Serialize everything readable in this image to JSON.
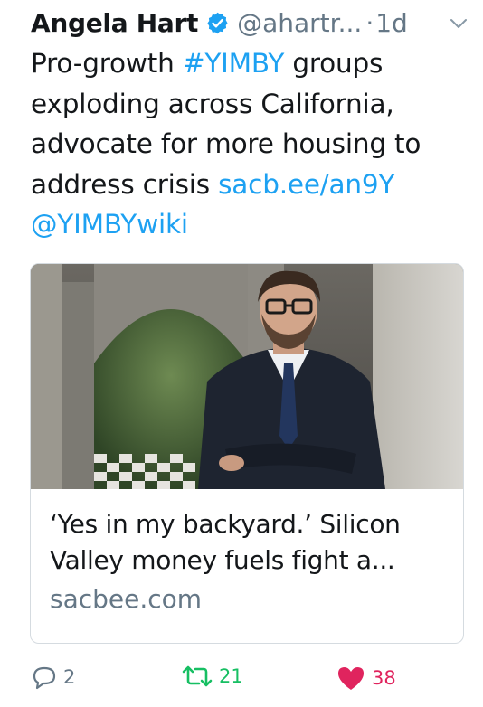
{
  "tweet": {
    "author_name": "Angela Hart",
    "handle": "@ahartr...",
    "separator": "·",
    "time": "1d",
    "text_parts": [
      {
        "text": "Pro-growth ",
        "link": false
      },
      {
        "text": "#YIMBY",
        "link": true
      },
      {
        "text": " groups exploding across California, advocate for more housing to address crisis ",
        "link": false
      },
      {
        "text": "sacb.ee/an9Y",
        "link": true
      },
      {
        "text": " ",
        "link": false
      },
      {
        "text": "@YIMBYwiki",
        "link": true
      }
    ]
  },
  "card": {
    "image_description_icon": "article-photo",
    "title": "‘Yes in my backyard.’ Silicon Valley money fuels fight a...",
    "domain": "sacbee.com"
  },
  "actions": {
    "reply_count": "2",
    "retweet_count": "21",
    "like_count": "38"
  },
  "colors": {
    "link": "#1da1f2",
    "secondary": "#657786",
    "retweet": "#17bf63",
    "like": "#e0245e",
    "verified": "#1da1f2"
  }
}
